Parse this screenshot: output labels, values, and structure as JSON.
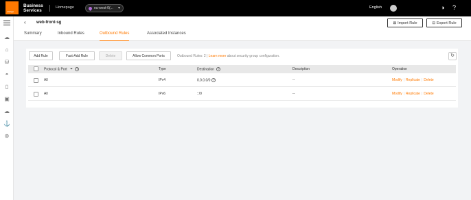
{
  "topbar": {
    "logo_text": "orange",
    "brand": "Business\nServices",
    "home": "Homepage",
    "region": "eu-west-0(...",
    "language": "English"
  },
  "header": {
    "title": "web-front-sg",
    "import_label": "Import Rule",
    "export_label": "Export Rule"
  },
  "tabs": [
    "Summary",
    "Inbound Rules",
    "Outbound Rules",
    "Associated Instances"
  ],
  "toolbar": {
    "add_rule": "Add Rule",
    "fast_add_rule": "Fast-Add Rule",
    "delete": "Delete",
    "allow_common_ports": "Allow Common Ports",
    "info_prefix": "Outbound Rules: 2 | ",
    "learn_more": "Learn more",
    "info_suffix": " about security group configuration."
  },
  "table": {
    "columns": {
      "protocol_port": "Protocol & Port",
      "type": "Type",
      "destination": "Destination",
      "description": "Description",
      "operation": "Operation"
    },
    "rows": [
      {
        "protocol": "All",
        "type": "IPv4",
        "destination": "0.0.0.0/0",
        "description": "--"
      },
      {
        "protocol": "All",
        "type": "IPv6",
        "destination": "::/0",
        "description": "--"
      }
    ],
    "actions": {
      "modify": "Modify",
      "replicate": "Replicate",
      "delete": "Delete"
    }
  },
  "colors": {
    "accent": "#ff7900",
    "topbar": "#000000"
  }
}
